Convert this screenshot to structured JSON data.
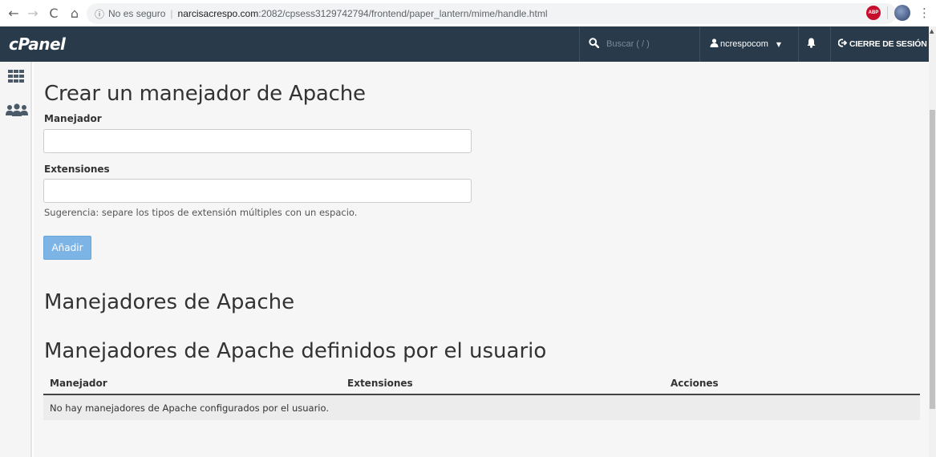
{
  "browser": {
    "back_glyph": "←",
    "forward_glyph": "→",
    "reload_glyph": "C",
    "home_glyph": "⌂",
    "info_glyph": "ⓘ",
    "insecure_label": "No es seguro",
    "url_host": "narcisacrespo.com",
    "url_path": ":2082/cpsess3129742794/frontend/paper_lantern/mime/handle.html",
    "star_glyph": "☆",
    "abp_label": "ABP",
    "menu_glyph": "⋮"
  },
  "header": {
    "logo": "cPanel",
    "search_icon_glyph": "🔍",
    "search_placeholder": "Buscar ( / )",
    "user_icon_glyph": "👤",
    "username": "ncrespocom",
    "caret_glyph": "▼",
    "bell_glyph": "🔔",
    "logout_icon_glyph": "⇥",
    "logout_label": "CIERRE DE SESIÓN"
  },
  "page": {
    "create_title": "Crear un manejador de Apache",
    "handler_label": "Manejador",
    "handler_value": "",
    "extensions_label": "Extensiones",
    "extensions_value": "",
    "hint": "Sugerencia: separe los tipos de extensión múltiples con un espacio.",
    "add_button": "Añadir",
    "handlers_title": "Manejadores de Apache",
    "user_handlers_title": "Manejadores de Apache definidos por el usuario"
  },
  "table": {
    "columns": [
      "Manejador",
      "Extensiones",
      "Acciones"
    ],
    "empty_message": "No hay manejadores de Apache configurados por el usuario."
  },
  "colors": {
    "header_bg": "#293a4a",
    "button_bg": "#7cb4e6",
    "content_bg": "#f6f6f6"
  }
}
